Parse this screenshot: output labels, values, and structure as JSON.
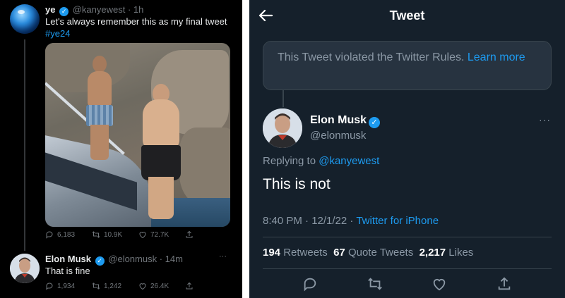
{
  "left": {
    "tweet1": {
      "name": "ye",
      "handle": "@kanyewest",
      "time": "· 1h",
      "text": "Let's always remember this as my final tweet",
      "hashtag": "#ye24",
      "replies": "6,183",
      "retweets": "10.9K",
      "likes": "72.7K"
    },
    "tweet2": {
      "name": "Elon Musk",
      "handle": "@elonmusk",
      "time": "· 14m",
      "more": "···",
      "text": "That is fine",
      "replies": "1,934",
      "retweets": "1,242",
      "likes": "26.4K"
    }
  },
  "right": {
    "title": "Tweet",
    "notice": "This Tweet violated the Twitter Rules.",
    "learn_more": "Learn more",
    "name": "Elon Musk",
    "handle": "@elonmusk",
    "more": "···",
    "replying_label": "Replying to",
    "replying_to": "@kanyewest",
    "text": "This is not",
    "timestamp": "8:40 PM · 12/1/22 ·",
    "client": "Twitter for iPhone",
    "retweets_count": "194",
    "retweets_label": "Retweets",
    "quote_count": "67",
    "quote_label": "Quote Tweets",
    "likes_count": "2,217",
    "likes_label": "Likes"
  },
  "colors": {
    "accent": "#1d9bf0",
    "left_bg": "#000000",
    "right_bg": "#15202b"
  }
}
